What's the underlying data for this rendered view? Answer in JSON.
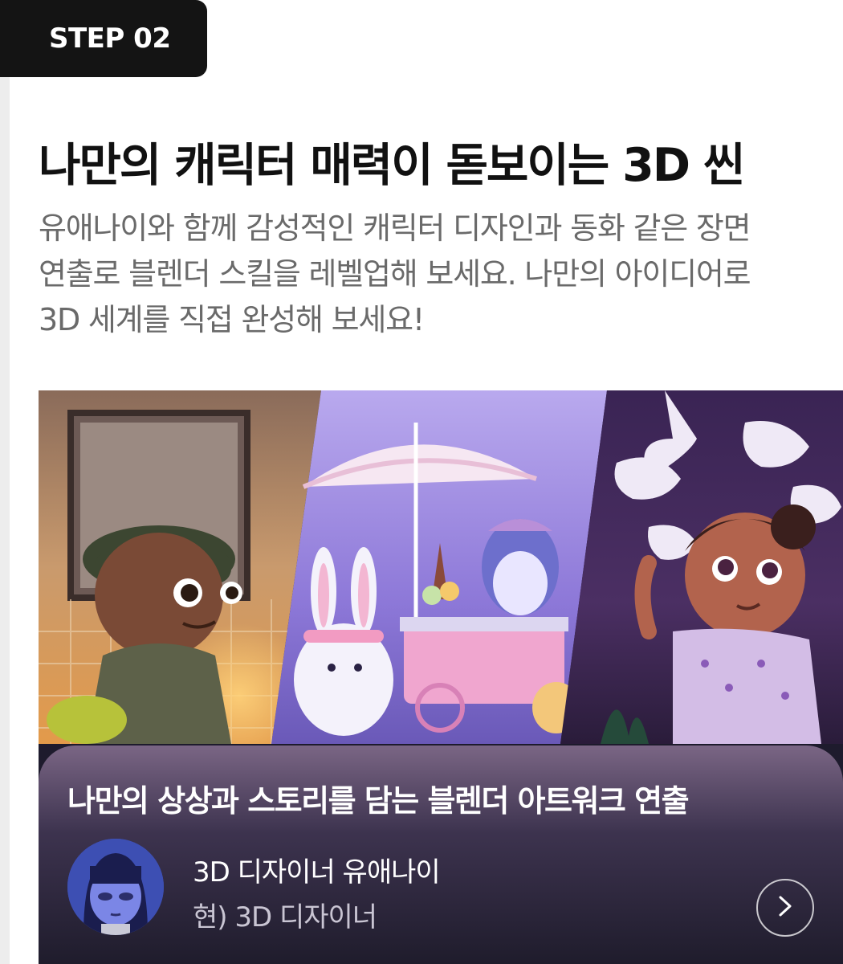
{
  "step_badge": {
    "label": "STEP 02"
  },
  "section": {
    "title": "나만의 캐릭터 매력이 돋보이는 3D 씬",
    "description_lines": [
      "유애나이와 함께 감성적인 캐릭터 디자인과 동화 같은 장면",
      "연출로 블렌더 스킬을 레벨업해 보세요. 나만의 아이디어로",
      "3D 세계를 직접 완성해 보세요!"
    ]
  },
  "hero": {
    "panels": [
      "boy-with-cap-scene",
      "bunny-penguin-ice-cream-scene",
      "girl-lily-of-the-valley-scene"
    ]
  },
  "course_card": {
    "title": "나만의 상상과 스토리를 담는 블렌더 아트워크 연출",
    "author_name": "3D 디자이너 유애나이",
    "author_role": "현) 3D 디자이너",
    "more_icon": "chevron-right-icon"
  },
  "colors": {
    "badge_bg": "#141414",
    "title": "#111111",
    "description": "#6a6a6a",
    "card_bottom": "#1f1c2c"
  }
}
